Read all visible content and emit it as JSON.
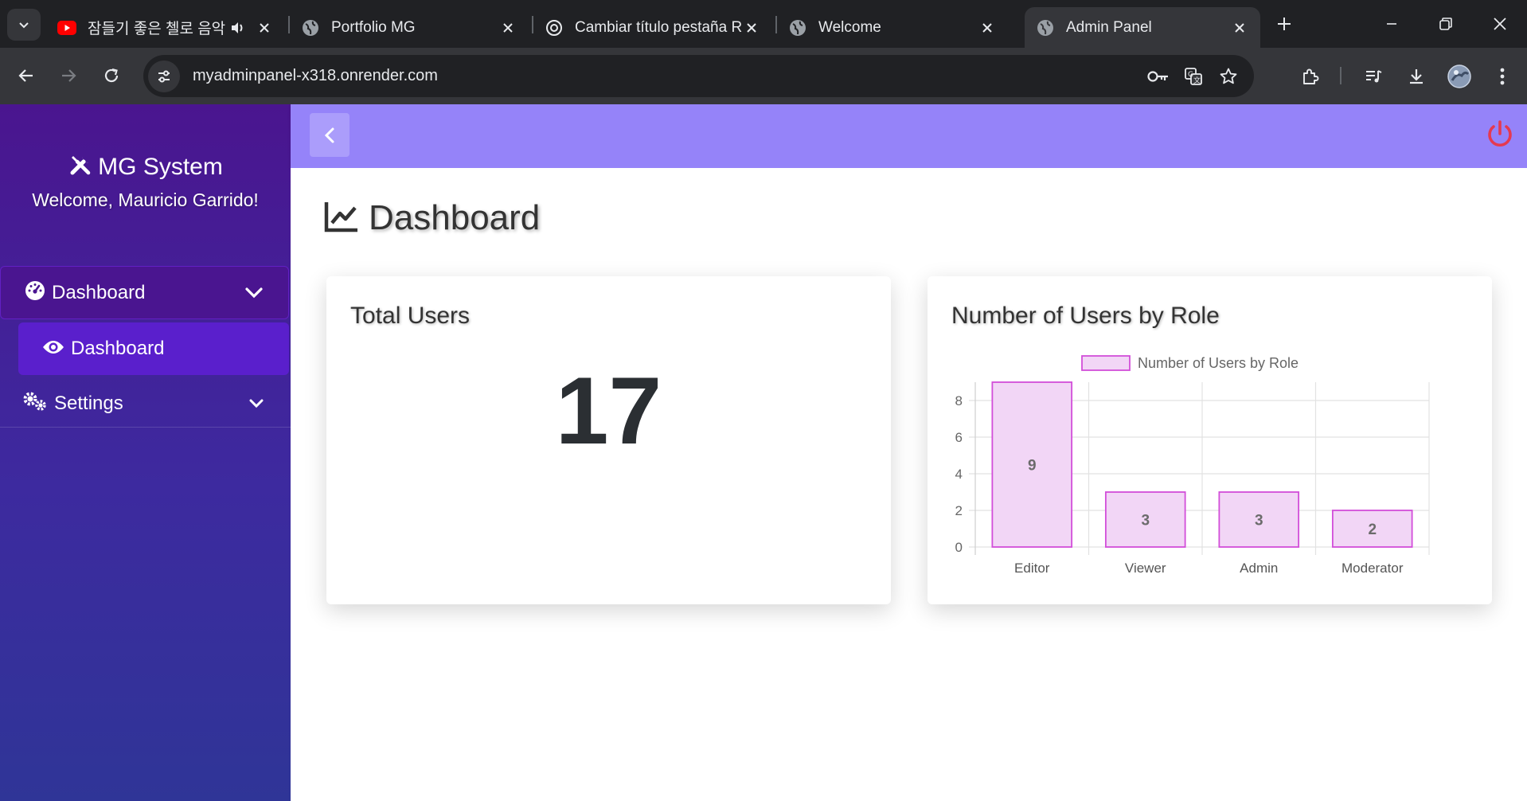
{
  "browser": {
    "tabs": [
      {
        "title": "잠들기 좋은 첼로 음악",
        "favicon": "youtube-icon",
        "audio": true,
        "active": false
      },
      {
        "title": "Portfolio MG",
        "favicon": "globe-icon",
        "active": false
      },
      {
        "title": "Cambiar título pestaña React",
        "favicon": "chatgpt-icon",
        "active": false
      },
      {
        "title": "Welcome",
        "favicon": "globe-icon",
        "active": false
      },
      {
        "title": "Admin Panel",
        "favicon": "globe-icon",
        "active": true
      }
    ],
    "url": "myadminpanel-x318.onrender.com"
  },
  "sidebar": {
    "brand_title": "MG System",
    "welcome": "Welcome, Mauricio Garrido!",
    "menu": {
      "dashboard_group": "Dashboard",
      "dashboard_item": "Dashboard",
      "settings_group": "Settings"
    }
  },
  "main": {
    "page_title": "Dashboard",
    "total_users_card": {
      "title": "Total Users",
      "value": "17"
    },
    "role_chart_card": {
      "title": "Number of Users by Role"
    }
  },
  "colors": {
    "sidebar_top": "#4a158f",
    "sidebar_bottom": "#2f3597",
    "topbar": "#9583f9",
    "power": "#e53950",
    "bar_fill": "#f2d6f6",
    "bar_stroke": "#d24ed9"
  },
  "chart_data": {
    "type": "bar",
    "categories": [
      "Editor",
      "Viewer",
      "Admin",
      "Moderator"
    ],
    "series": [
      {
        "name": "Number of Users by Role",
        "values": [
          9,
          3,
          3,
          2
        ]
      }
    ],
    "data_labels": [
      "9",
      "3",
      "3",
      "2"
    ],
    "yticks": [
      "0",
      "2",
      "4",
      "6",
      "8"
    ],
    "ylim": [
      0,
      9
    ],
    "grid": true,
    "legend_position": "top"
  }
}
